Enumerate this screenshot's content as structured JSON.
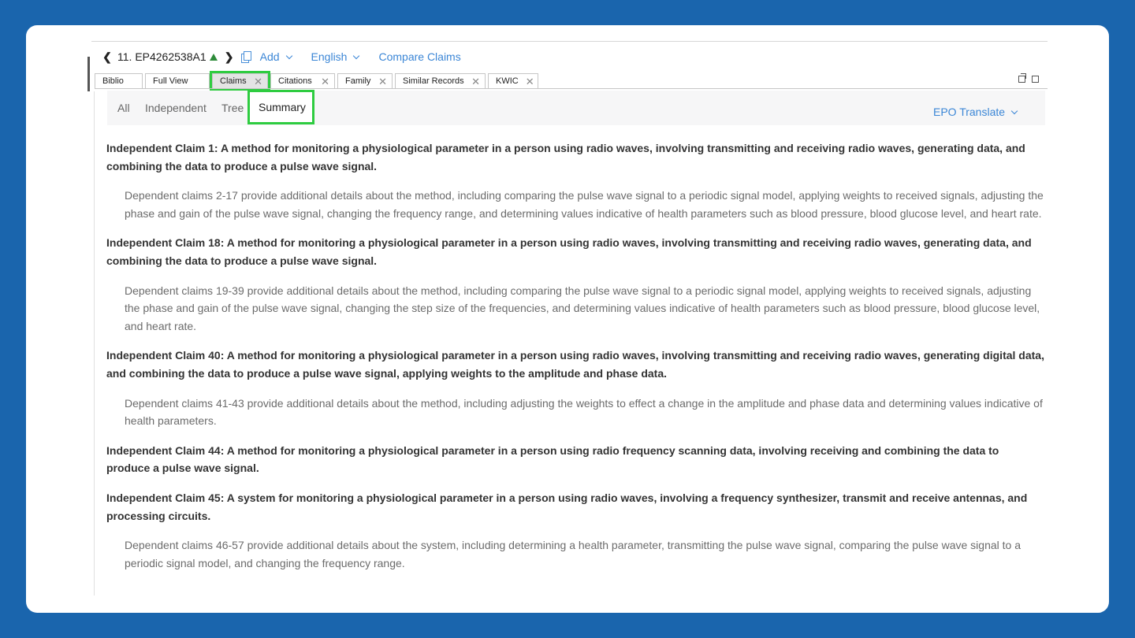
{
  "toolbar": {
    "record": "11. EP4262538A1",
    "add_label": "Add",
    "language_label": "English",
    "compare_label": "Compare Claims"
  },
  "tabs": [
    {
      "label": "Biblio",
      "closable": false
    },
    {
      "label": "Full View",
      "closable": false
    },
    {
      "label": "Claims",
      "closable": true
    },
    {
      "label": "Citations",
      "closable": true
    },
    {
      "label": "Family",
      "closable": true
    },
    {
      "label": "Similar Records",
      "closable": true
    },
    {
      "label": "KWIC",
      "closable": true
    }
  ],
  "active_tab": "Claims",
  "subtabs": {
    "all": "All",
    "independent": "Independent",
    "tree": "Tree",
    "summary": "Summary"
  },
  "active_subtab": "Summary",
  "translate_label": "EPO Translate",
  "highlight_color": "#2ecc40",
  "accent_color": "#3b86d6",
  "claims": [
    {
      "type": "independent",
      "text": "Independent Claim 1: A method for monitoring a physiological parameter in a person using radio waves, involving transmitting and receiving radio waves, generating data, and combining the data to produce a pulse wave signal."
    },
    {
      "type": "dependent",
      "text": "Dependent claims 2-17 provide additional details about the method, including comparing the pulse wave signal to a periodic signal model, applying weights to received signals, adjusting the phase and gain of the pulse wave signal, changing the frequency range, and determining values indicative of health parameters such as blood pressure, blood glucose level, and heart rate."
    },
    {
      "type": "independent",
      "text": "Independent Claim 18: A method for monitoring a physiological parameter in a person using radio waves, involving transmitting and receiving radio waves, generating data, and combining the data to produce a pulse wave signal."
    },
    {
      "type": "dependent",
      "text": "Dependent claims 19-39 provide additional details about the method, including comparing the pulse wave signal to a periodic signal model, applying weights to received signals, adjusting the phase and gain of the pulse wave signal, changing the step size of the frequencies, and determining values indicative of health parameters such as blood pressure, blood glucose level, and heart rate."
    },
    {
      "type": "independent",
      "text": "Independent Claim 40: A method for monitoring a physiological parameter in a person using radio waves, involving transmitting and receiving radio waves, generating digital data, and combining the data to produce a pulse wave signal, applying weights to the amplitude and phase data."
    },
    {
      "type": "dependent",
      "text": "Dependent claims 41-43 provide additional details about the method, including adjusting the weights to effect a change in the amplitude and phase data and determining values indicative of health parameters."
    },
    {
      "type": "independent",
      "text": "Independent Claim 44: A method for monitoring a physiological parameter in a person using radio frequency scanning data, involving receiving and combining the data to produce a pulse wave signal."
    },
    {
      "type": "independent",
      "text": "Independent Claim 45: A system for monitoring a physiological parameter in a person using radio waves, involving a frequency synthesizer, transmit and receive antennas, and processing circuits."
    },
    {
      "type": "dependent",
      "text": "Dependent claims 46-57 provide additional details about the system, including determining a health parameter, transmitting the pulse wave signal, comparing the pulse wave signal to a periodic signal model, and changing the frequency range."
    }
  ]
}
